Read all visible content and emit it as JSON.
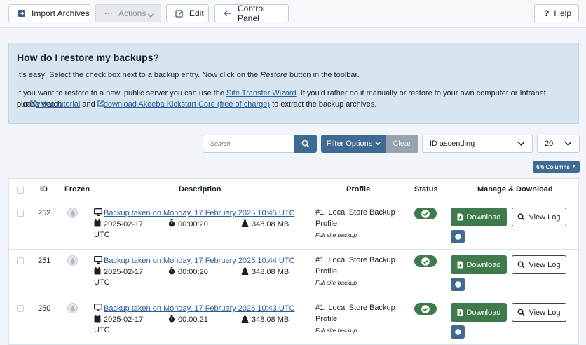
{
  "toolbar": {
    "import_label": "Import Archives",
    "actions_label": "Actions",
    "edit_label": "Edit",
    "control_panel_label": "Control Panel",
    "help_label": "Help"
  },
  "info": {
    "title": "How do I restore my backups?",
    "p1_a": "It's easy! Select the check box next to a backup entry. Now click on the ",
    "p1_em": "Restore",
    "p1_b": " button in the toolbar.",
    "p2_a": "If you want to restore to a new, public server you can use the ",
    "p2_link1": "Site Transfer Wizard",
    "p2_b": ". If you'd rather do it manually or restore to your own computer or Intranet please watch",
    "p3_a": "our ",
    "p3_link2": "video tutorial",
    "p3_b": " and ",
    "p3_link3": "download Akeeba Kickstart Core (free of charge)",
    "p3_c": " to extract the backup archives."
  },
  "filters": {
    "search_placeholder": "Search",
    "filter_options_label": "Filter Options",
    "clear_label": "Clear",
    "sort_value": "ID ascending",
    "limit_value": "20",
    "columns_label": "6/6 Columns"
  },
  "table": {
    "headers": {
      "id": "ID",
      "frozen": "Frozen",
      "description": "Description",
      "profile": "Profile",
      "status": "Status",
      "manage": "Manage & Download"
    },
    "download_label": "Download",
    "view_log_label": "View Log",
    "rows": [
      {
        "id": "252",
        "description": "Backup taken on Monday, 17 February 2025 10:45 UTC",
        "date": "2025-02-17",
        "tz": "UTC",
        "duration": "00:00:20",
        "size": "348.08 MB",
        "profile_a": "#1. Local Store Backup",
        "profile_b": "Profile",
        "type": "Full site backup"
      },
      {
        "id": "251",
        "description": "Backup taken on Monday, 17 February 2025 10:44 UTC",
        "date": "2025-02-17",
        "tz": "UTC",
        "duration": "00:00:20",
        "size": "348.08 MB",
        "profile_a": "#1. Local Store Backup",
        "profile_b": "Profile",
        "type": "Full site backup"
      },
      {
        "id": "250",
        "description": "Backup taken on Monday, 17 February 2025 10:43 UTC",
        "date": "2025-02-17",
        "tz": "UTC",
        "duration": "00:00:21",
        "size": "348.08 MB",
        "profile_a": "#1. Local Store Backup",
        "profile_b": "Profile",
        "type": "Full site backup"
      }
    ]
  },
  "colors": {
    "primary": "#3f6a93",
    "success": "#3e7a4c",
    "info_bg": "#d7e5f1",
    "link": "#2a5d9a"
  }
}
